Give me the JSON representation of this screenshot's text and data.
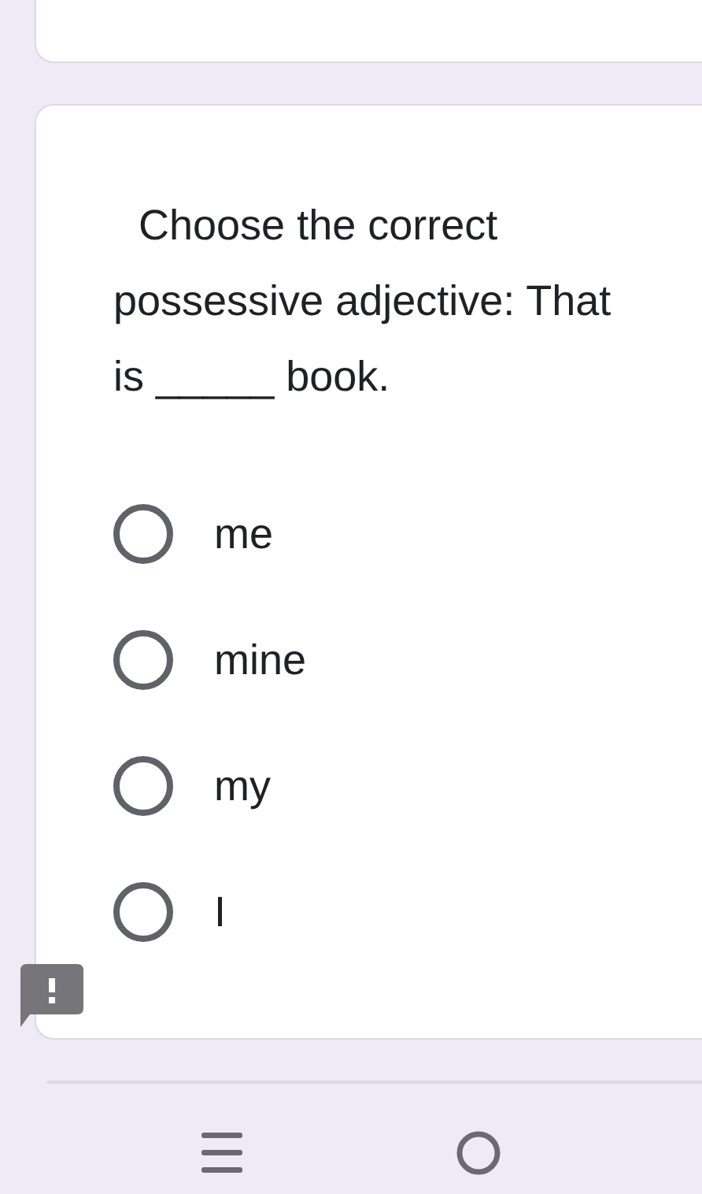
{
  "question": {
    "text": "Choose the correct possessive adjective: That is _____ book."
  },
  "options": [
    {
      "label": "me",
      "selected": false
    },
    {
      "label": "mine",
      "selected": false
    },
    {
      "label": "my",
      "selected": false
    },
    {
      "label": "I",
      "selected": false
    }
  ]
}
